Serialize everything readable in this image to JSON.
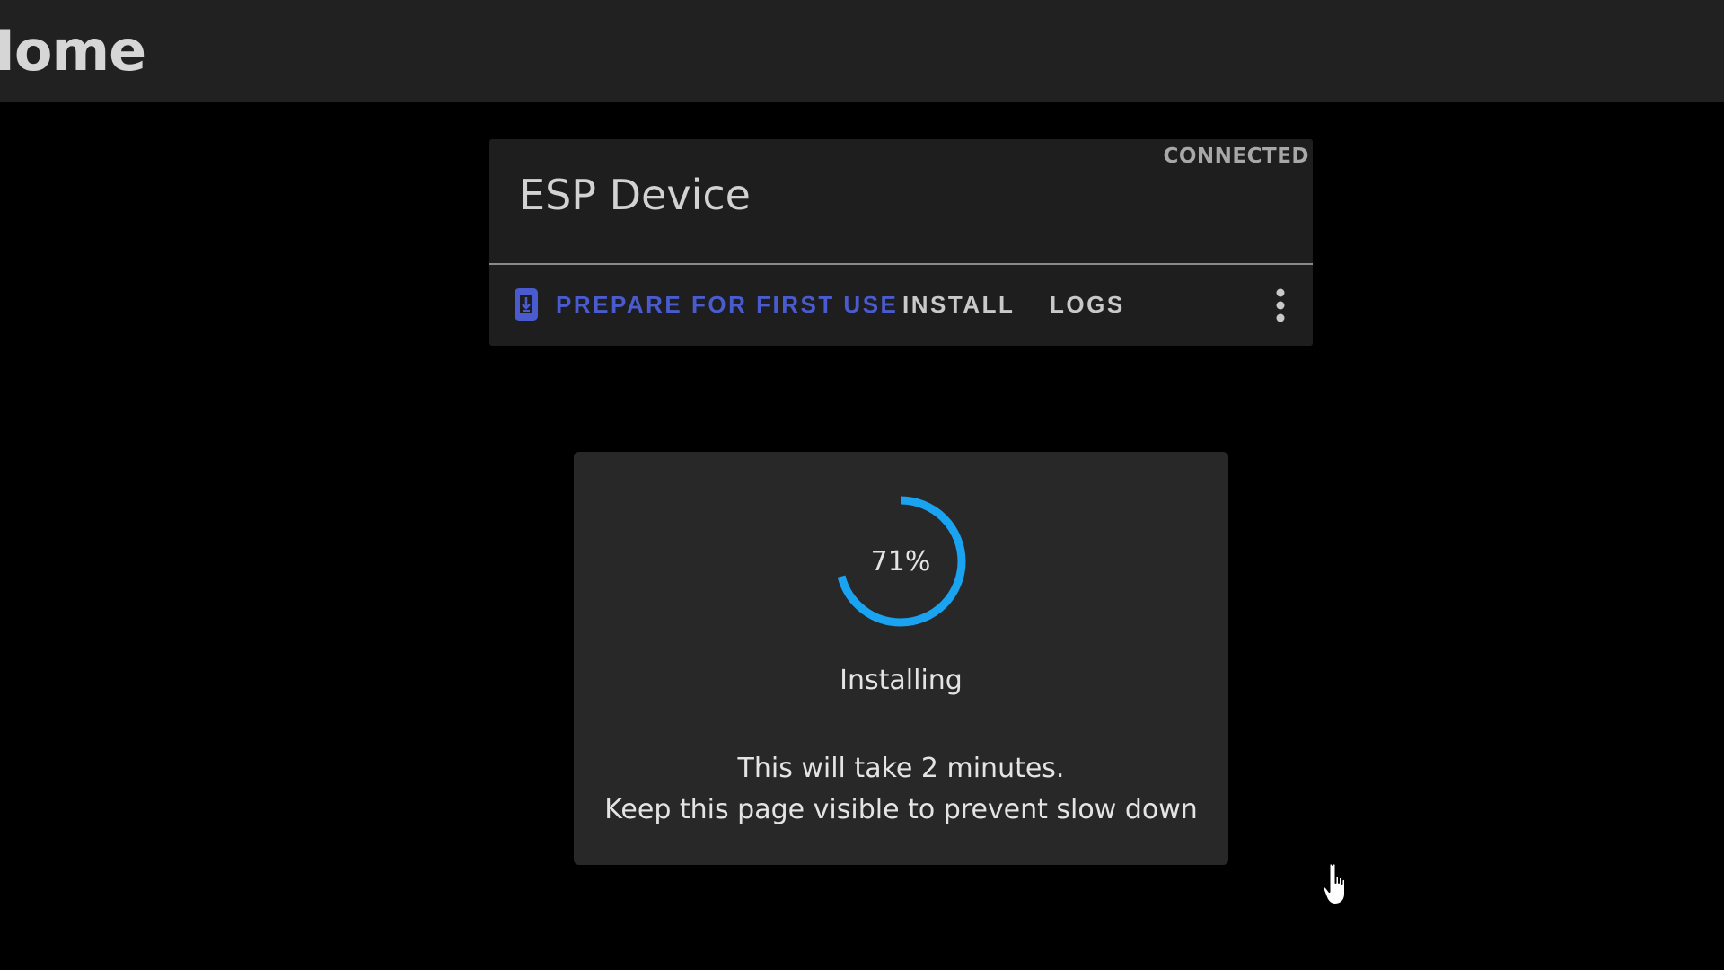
{
  "header": {
    "title": "Home"
  },
  "device_card": {
    "title": "ESP Device",
    "status": "CONNECTED",
    "actions": {
      "prepare_label": "PREPARE FOR FIRST USE",
      "install_label": "INSTALL",
      "logs_label": "LOGS"
    },
    "icons": {
      "prepare_icon": "phone-download-icon",
      "menu_icon": "more-vert-icon"
    }
  },
  "progress_dialog": {
    "percent": 71,
    "percent_label": "71%",
    "title": "Installing",
    "message_line1": "This will take 2 minutes.",
    "message_line2": "Keep this page visible to prevent slow down"
  },
  "colors": {
    "accent": "#4a5bd0",
    "progress": "#1aa3f0",
    "header_bg": "#212121",
    "card_bg": "#1e1e1e",
    "dialog_bg": "#282828",
    "page_bg": "#000000"
  },
  "cursor": {
    "type": "hand-pointer-icon"
  }
}
